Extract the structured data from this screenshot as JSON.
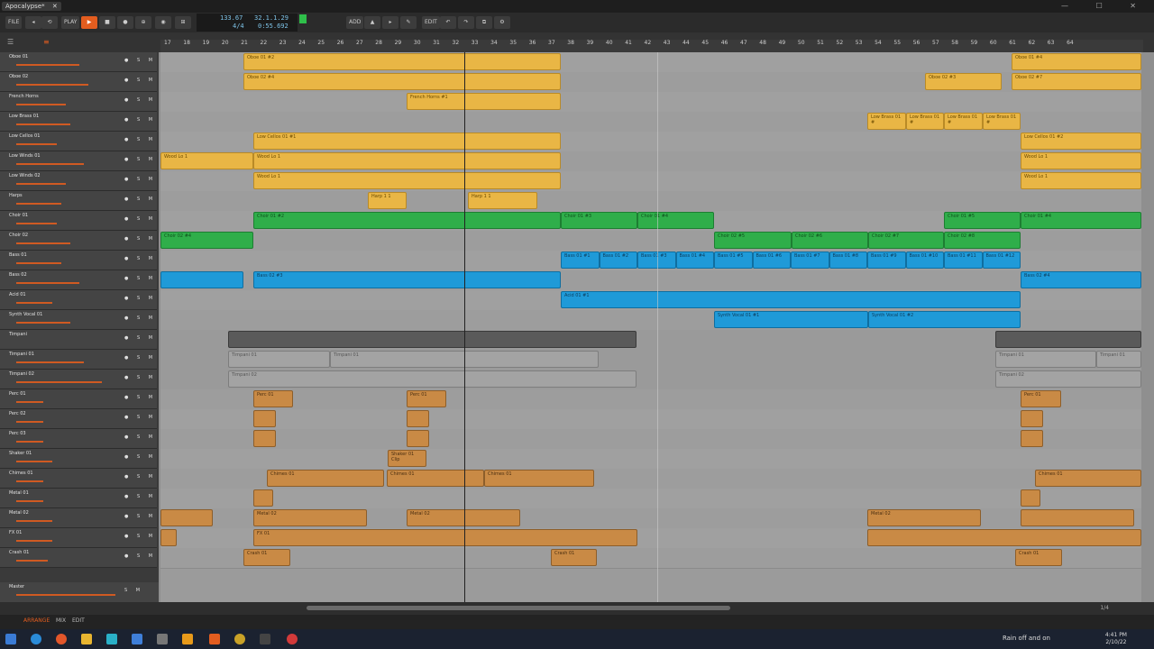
{
  "window": {
    "title": "Apocalypse*",
    "close_glyph": "✕",
    "controls": "— ☐ ✕"
  },
  "toolbar": {
    "file_label": "FILE",
    "play_label": "PLAY",
    "add_label": "ADD",
    "edit_label": "EDIT"
  },
  "transport": {
    "tempo": "133.67",
    "time_signature": "4/4",
    "position_bars": "32.1.1.29",
    "position_time": "0:55.692"
  },
  "ruler": {
    "bars": [
      "17",
      "18",
      "19",
      "20",
      "21",
      "22",
      "23",
      "24",
      "25",
      "26",
      "27",
      "28",
      "29",
      "30",
      "31",
      "32",
      "33",
      "34",
      "35",
      "36",
      "37",
      "38",
      "39",
      "40",
      "41",
      "42",
      "43",
      "44",
      "45",
      "46",
      "47",
      "48",
      "49",
      "50",
      "51",
      "52",
      "53",
      "54",
      "55",
      "56",
      "57",
      "58",
      "59",
      "60",
      "61",
      "62",
      "63",
      "64"
    ]
  },
  "tracks": [
    {
      "name": "Oboe 01"
    },
    {
      "name": "Oboe 02"
    },
    {
      "name": "French Horns"
    },
    {
      "name": "Low Brass 01"
    },
    {
      "name": "Low Cellos 01"
    },
    {
      "name": "Low Winds 01"
    },
    {
      "name": "Low Winds 02"
    },
    {
      "name": "Harps"
    },
    {
      "name": "Choir 01"
    },
    {
      "name": "Choir 02"
    },
    {
      "name": "Bass 01"
    },
    {
      "name": "Bass 02"
    },
    {
      "name": "Acid 01"
    },
    {
      "name": "Synth Vocal 01"
    },
    {
      "name": "Timpani"
    },
    {
      "name": "Timpani 01"
    },
    {
      "name": "Timpani 02"
    },
    {
      "name": "Perc 01"
    },
    {
      "name": "Perc 02"
    },
    {
      "name": "Perc 03"
    },
    {
      "name": "Shaker 01"
    },
    {
      "name": "Chimes 01"
    },
    {
      "name": "Metal 01"
    },
    {
      "name": "Metal 02"
    },
    {
      "name": "FX 01"
    },
    {
      "name": "Crash 01"
    }
  ],
  "master": {
    "name": "Master"
  },
  "clips": {
    "oboe01_a": "Oboe 01 #2",
    "oboe01_b": "Oboe 01 #4",
    "oboe02_a": "Oboe 02 #4",
    "oboe02_b": "Oboe 02 #3",
    "oboe02_c": "Oboe 02 #7",
    "horns_a": "French Horns #1",
    "brass": [
      "Low Brass 01 #",
      "Low Brass 01 #",
      "Low Brass 01 #",
      "Low Brass 01 #"
    ],
    "cellos_a": "Low Cellos 01 #1",
    "cellos_b": "Low Cellos 01 #2",
    "winds01_a": "Wood Lo 1",
    "winds01_b": "Wood Lo 1",
    "winds01_c": "Wood Lo 1",
    "winds02_a": "Wood Lo 1",
    "winds02_b": "Wood Lo 1",
    "harp_a": "Harp 1 1",
    "harp_b": "Harp 1 1",
    "choir01_a": "Choir 01 #2",
    "choir01_b": "Choir 01 #3",
    "choir01_c": "Choir 01 #4",
    "choir01_d": "Choir 01 #5",
    "choir01_e": "Choir 01 #4",
    "choir02_a": "Choir 02 #4",
    "choir02_b": "Choir 02 #5",
    "choir02_c": "Choir 02 #6",
    "choir02_d": "Choir 02 #7",
    "choir02_e": "Choir 02 #8",
    "bass01": [
      "Bass 01 #1",
      "Bass 01 #2",
      "Bass 01 #3",
      "Bass 01 #4",
      "Bass 01 #5",
      "Bass 01 #6",
      "Bass 01 #7",
      "Bass 01 #8",
      "Bass 01 #9",
      "Bass 01 #10",
      "Bass 01 #11",
      "Bass 01 #12"
    ],
    "bass02_a": "Bass 02 #3",
    "bass02_b": "Bass 02 #4",
    "acid": "Acid 01 #1",
    "synth_a": "Synth Vocal 01 #1",
    "synth_b": "Synth Vocal 01 #2",
    "timp01_a": "Timpani 01",
    "timp01_b": "Timpani 01",
    "timp01_c": "Timpani 01",
    "timp01_d": "Timpani 01",
    "timp02_a": "Timpani 02",
    "timp02_b": "Timpani 02",
    "perc_a": "Perc 01",
    "perc_b": "Perc 01",
    "perc_c": "Perc 01",
    "shaker": "Shaker 01 Clip",
    "chimes_a": "Chimes 01",
    "chimes_b": "Chimes 01",
    "chimes_c": "Chimes 01",
    "chimes_d": "Chimes 01",
    "metal_a": "Metal 02",
    "metal_b": "Metal 02",
    "metal_c": "Metal 02",
    "fx": "FX 01",
    "crash_a": "Crash 01",
    "crash_b": "Crash 01",
    "crash_c": "Crash 01"
  },
  "modebar": {
    "arrange": "ARRANGE",
    "mix": "MIX",
    "edit": "EDIT"
  },
  "zoom": "1/4",
  "taskbar": {
    "weather": "Rain off and on",
    "time": "4:41 PM",
    "date": "2/10/22"
  },
  "colors": {
    "accent": "#e35d1f",
    "yellow_clip": "#e9b645",
    "green_clip": "#2fae4a",
    "blue_clip": "#1f9ad8",
    "orange_clip": "#c98a45"
  }
}
